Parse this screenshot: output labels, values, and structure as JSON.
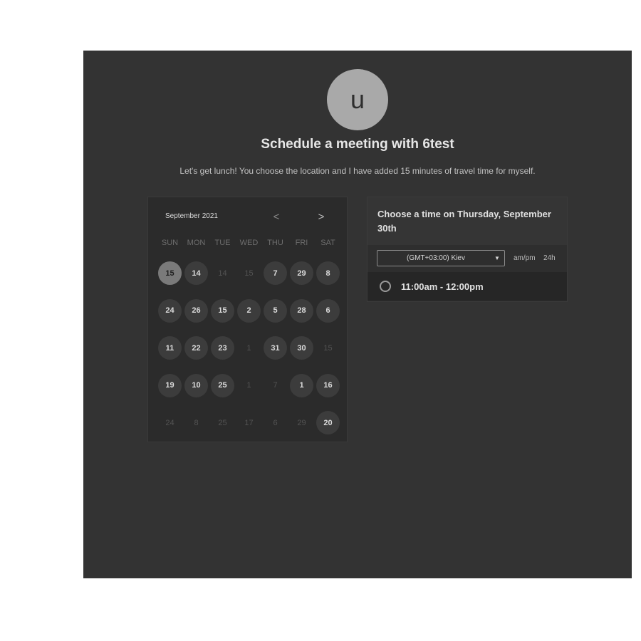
{
  "header": {
    "avatar_initial": "u",
    "title": "Schedule a meeting with 6test",
    "description": "Let's get lunch! You choose the location and I have added 15 minutes of travel time for myself."
  },
  "calendar": {
    "month_label": "September 2021",
    "prev_label": "<",
    "next_label": ">",
    "weekdays": [
      "SUN",
      "MON",
      "TUE",
      "WED",
      "THU",
      "FRI",
      "SAT"
    ],
    "days": [
      {
        "label": "15",
        "state": "selected"
      },
      {
        "label": "14",
        "state": "available"
      },
      {
        "label": "14",
        "state": "unavailable"
      },
      {
        "label": "15",
        "state": "unavailable"
      },
      {
        "label": "7",
        "state": "available"
      },
      {
        "label": "29",
        "state": "available"
      },
      {
        "label": "8",
        "state": "available"
      },
      {
        "label": "24",
        "state": "available"
      },
      {
        "label": "26",
        "state": "available"
      },
      {
        "label": "15",
        "state": "available"
      },
      {
        "label": "2",
        "state": "available"
      },
      {
        "label": "5",
        "state": "available"
      },
      {
        "label": "28",
        "state": "available"
      },
      {
        "label": "6",
        "state": "available"
      },
      {
        "label": "11",
        "state": "available"
      },
      {
        "label": "22",
        "state": "available"
      },
      {
        "label": "23",
        "state": "available"
      },
      {
        "label": "1",
        "state": "unavailable"
      },
      {
        "label": "31",
        "state": "available"
      },
      {
        "label": "30",
        "state": "available"
      },
      {
        "label": "15",
        "state": "unavailable"
      },
      {
        "label": "19",
        "state": "available"
      },
      {
        "label": "10",
        "state": "available"
      },
      {
        "label": "25",
        "state": "available"
      },
      {
        "label": "1",
        "state": "unavailable"
      },
      {
        "label": "7",
        "state": "unavailable"
      },
      {
        "label": "1",
        "state": "available"
      },
      {
        "label": "16",
        "state": "available"
      },
      {
        "label": "24",
        "state": "unavailable"
      },
      {
        "label": "8",
        "state": "unavailable"
      },
      {
        "label": "25",
        "state": "unavailable"
      },
      {
        "label": "17",
        "state": "unavailable"
      },
      {
        "label": "6",
        "state": "unavailable"
      },
      {
        "label": "29",
        "state": "unavailable"
      },
      {
        "label": "20",
        "state": "available"
      }
    ]
  },
  "time_picker": {
    "title": "Choose a time on Thursday, September 30th",
    "timezone": "(GMT+03:00) Kiev",
    "format_ampm": "am/pm",
    "format_24h": "24h",
    "slots": [
      "11:00am - 12:00pm"
    ]
  },
  "colors": {
    "background": "#333333",
    "page": "#ffffff",
    "avatar": "#a9a9a9",
    "selected_day": "#7a7a7a"
  }
}
